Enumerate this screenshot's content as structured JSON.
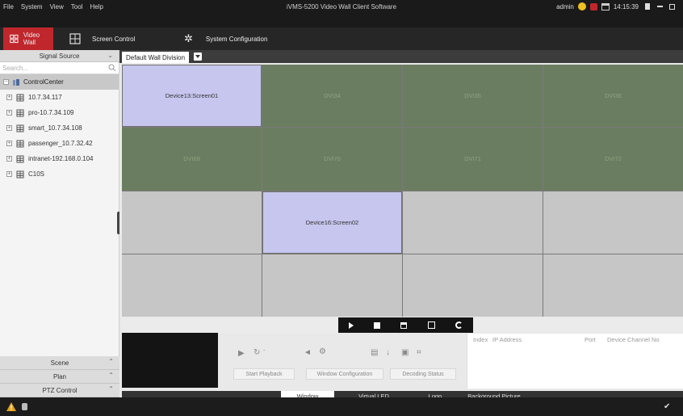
{
  "menu": [
    "File",
    "System",
    "View",
    "Tool",
    "Help"
  ],
  "app_title": "iVMS-5200 Video Wall Client Software",
  "status": {
    "user": "admin",
    "time": "14:15:39"
  },
  "nav": {
    "video_wall": "Video Wall",
    "screen_control": "Screen Control",
    "system_configuration": "System Configuration"
  },
  "sidebar": {
    "signal_source": "Signal Source",
    "search_placeholder": "Search...",
    "root": "ControlCenter",
    "items": [
      "10.7.34.117",
      "pro-10.7.34.109",
      "smart_10.7.34.108",
      "passenger_10.7.32.42",
      "intranet-192.168.0.104",
      "C10S"
    ],
    "scene": "Scene",
    "plan": "Plan",
    "ptz": "PTZ Control"
  },
  "wall_tab": "Default Wall Division",
  "cells": [
    "Device13:Screen01",
    "DVI34",
    "DVI35",
    "DVI36",
    "DVI69",
    "DVI70",
    "DVI71",
    "DVI72",
    "",
    "Device16:Screen02",
    "",
    "",
    "",
    "",
    "",
    ""
  ],
  "actions": {
    "start_playback": "Start Playback",
    "window_configuration": "Window Configuration",
    "decoding_status": "Decoding Status"
  },
  "list_columns": {
    "index": "Index",
    "ip": "IP Address",
    "port": "Port",
    "channel": "Device Channel No"
  },
  "bottom_tabs": [
    "Window",
    "Virtual LED",
    "Logo",
    "Background Picture"
  ],
  "colors": {
    "accent": "#c0272d",
    "dvi_cell": "#6b7d60",
    "screen_cell": "#c6c6ef",
    "empty_cell": "#c6c6c6"
  }
}
